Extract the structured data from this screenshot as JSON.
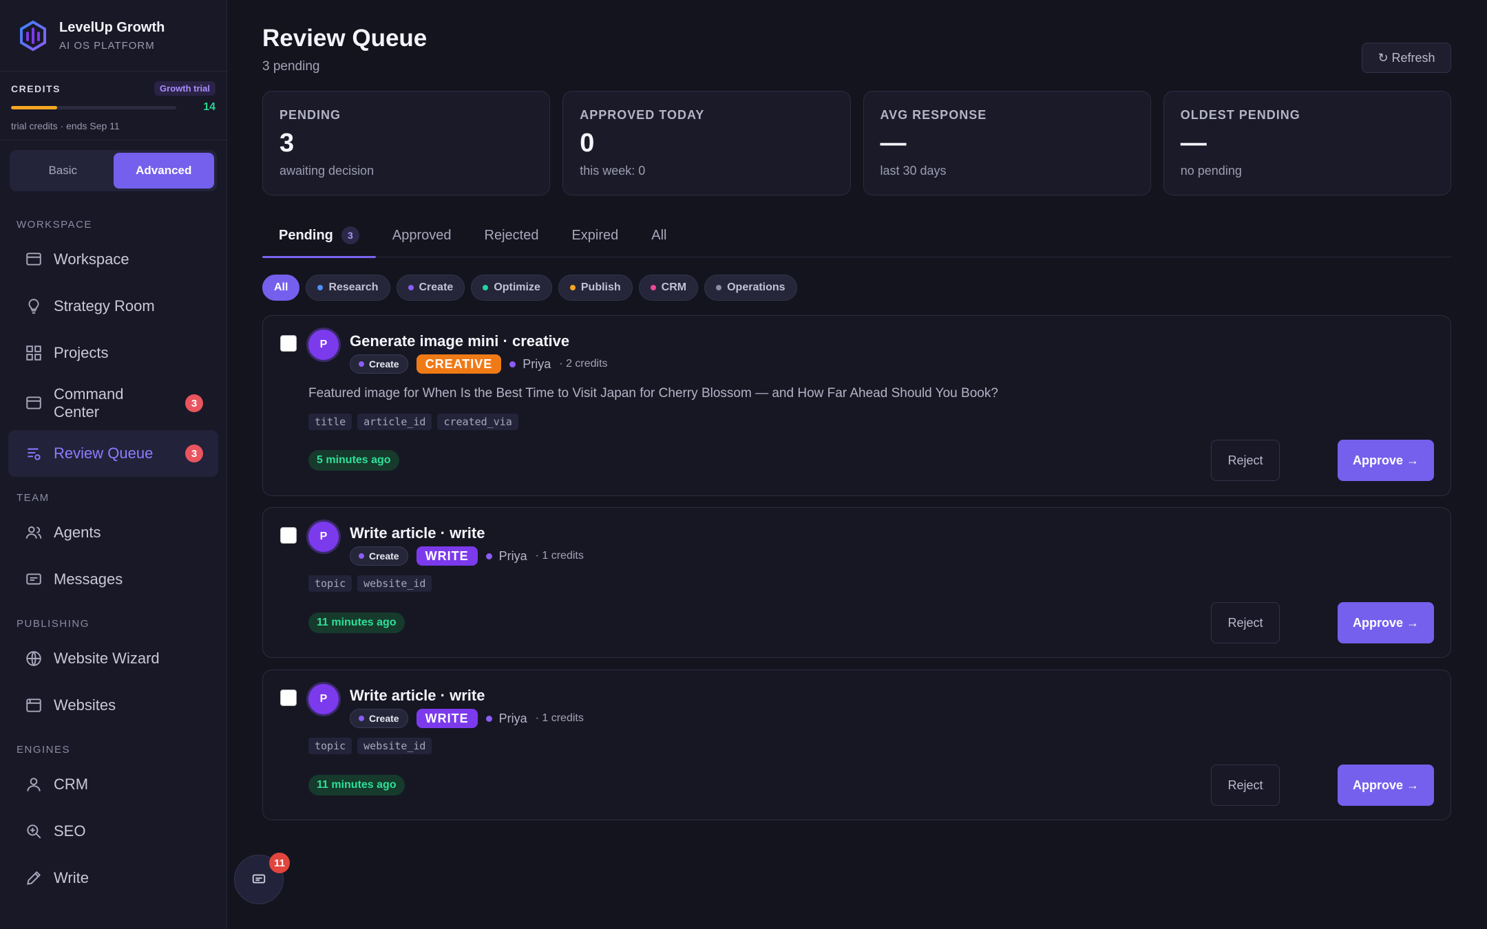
{
  "brand": {
    "name": "LevelUp Growth",
    "subtitle": "AI OS PLATFORM"
  },
  "credits": {
    "label": "CREDITS",
    "plan_badge": "Growth trial",
    "count": "14",
    "progress_fraction": 0.28,
    "note": "trial credits · ends Sep 11"
  },
  "mode_toggle": {
    "basic": "Basic",
    "advanced": "Advanced",
    "selected": "Advanced"
  },
  "sidebar": {
    "sections": [
      {
        "label": "WORKSPACE",
        "items": [
          {
            "label": "Workspace",
            "icon": "monitor-icon"
          },
          {
            "label": "Strategy Room",
            "icon": "lightbulb-icon"
          },
          {
            "label": "Projects",
            "icon": "grid-icon"
          },
          {
            "label": "Command\nCenter",
            "icon": "window-icon",
            "badge": "3"
          },
          {
            "label": "Review Queue",
            "icon": "review-list-icon",
            "badge": "3",
            "active": true
          }
        ]
      },
      {
        "label": "TEAM",
        "items": [
          {
            "label": "Agents",
            "icon": "users-icon"
          },
          {
            "label": "Messages",
            "icon": "message-icon"
          }
        ]
      },
      {
        "label": "PUBLISHING",
        "items": [
          {
            "label": "Website Wizard",
            "icon": "globe-icon"
          },
          {
            "label": "Websites",
            "icon": "browser-icon"
          }
        ]
      },
      {
        "label": "ENGINES",
        "items": [
          {
            "label": "CRM",
            "icon": "person-icon"
          },
          {
            "label": "SEO",
            "icon": "search-zoom-icon"
          },
          {
            "label": "Write",
            "icon": "pencil-icon"
          }
        ]
      }
    ]
  },
  "page": {
    "title": "Review Queue",
    "subtitle": "3 pending",
    "refresh_label": "↻ Refresh"
  },
  "stats": [
    {
      "label": "PENDING",
      "value": "3",
      "note": "awaiting decision"
    },
    {
      "label": "APPROVED TODAY",
      "value": "0",
      "note": "this week: 0"
    },
    {
      "label": "AVG RESPONSE",
      "value": "—",
      "note": "last 30 days"
    },
    {
      "label": "OLDEST PENDING",
      "value": "—",
      "note": "no pending"
    }
  ],
  "tabs": [
    {
      "label": "Pending",
      "count": "3",
      "active": true
    },
    {
      "label": "Approved"
    },
    {
      "label": "Rejected"
    },
    {
      "label": "Expired"
    },
    {
      "label": "All"
    }
  ],
  "filters": [
    {
      "label": "All",
      "active": true
    },
    {
      "label": "Research",
      "color": "#4f8ff7"
    },
    {
      "label": "Create",
      "color": "#8b5cf6"
    },
    {
      "label": "Optimize",
      "color": "#22d3a0"
    },
    {
      "label": "Publish",
      "color": "#f5a623"
    },
    {
      "label": "CRM",
      "color": "#ec4899"
    },
    {
      "label": "Operations",
      "color": "#8b8ba3"
    }
  ],
  "queue": [
    {
      "avatar": "P",
      "title": "Generate image mini · creative",
      "category": "Create",
      "type": "CREATIVE",
      "type_color": "#f07a16",
      "agent": "Priya",
      "cost": "· 2 credits",
      "description": "Featured image for When Is the Best Time to Visit Japan for Cherry Blossom — and How Far Ahead Should You Book?",
      "params": [
        "title",
        "article_id",
        "created_via"
      ],
      "time": "5 minutes ago",
      "reject_label": "Reject",
      "approve_label": "Approve →"
    },
    {
      "avatar": "P",
      "title": "Write article · write",
      "category": "Create",
      "type": "WRITE",
      "type_color": "#7c3aed",
      "agent": "Priya",
      "cost": "· 1 credits",
      "params": [
        "topic",
        "website_id"
      ],
      "time": "11 minutes ago",
      "reject_label": "Reject",
      "approve_label": "Approve →"
    },
    {
      "avatar": "P",
      "title": "Write article · write",
      "category": "Create",
      "type": "WRITE",
      "type_color": "#7c3aed",
      "agent": "Priya",
      "cost": "· 1 credits",
      "params": [
        "topic",
        "website_id"
      ],
      "time": "11 minutes ago",
      "reject_label": "Reject",
      "approve_label": "Approve →"
    }
  ],
  "chat": {
    "badge": "11",
    "icon": "chat-icon"
  }
}
